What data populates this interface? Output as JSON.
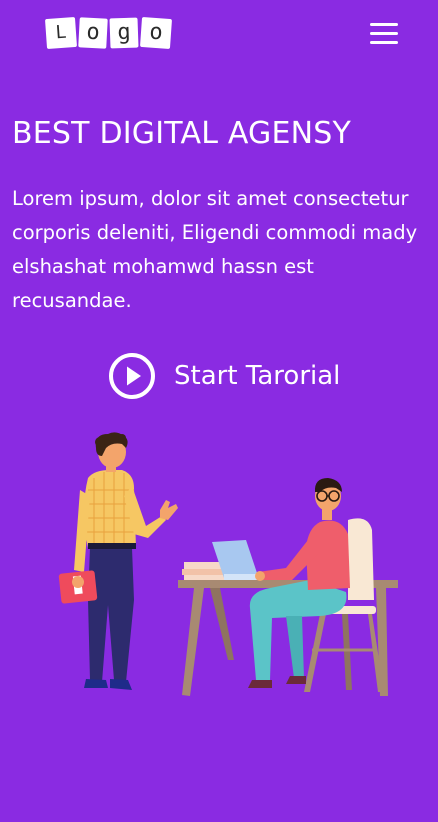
{
  "header": {
    "logo_letters": [
      "L",
      "o",
      "g",
      "o"
    ],
    "menu_icon": "hamburger-icon"
  },
  "hero": {
    "title": "BEST DIGITAL AGENSY",
    "description": "Lorem ipsum, dolor sit amet consectetur corporis deleniti, Eligendi commodi mady elshashat mohamwd hassn est recusandae.",
    "cta_label": "Start Tarorial",
    "cta_icon": "play-circle-icon"
  },
  "colors": {
    "background": "#8a2be2",
    "text": "#ffffff"
  }
}
